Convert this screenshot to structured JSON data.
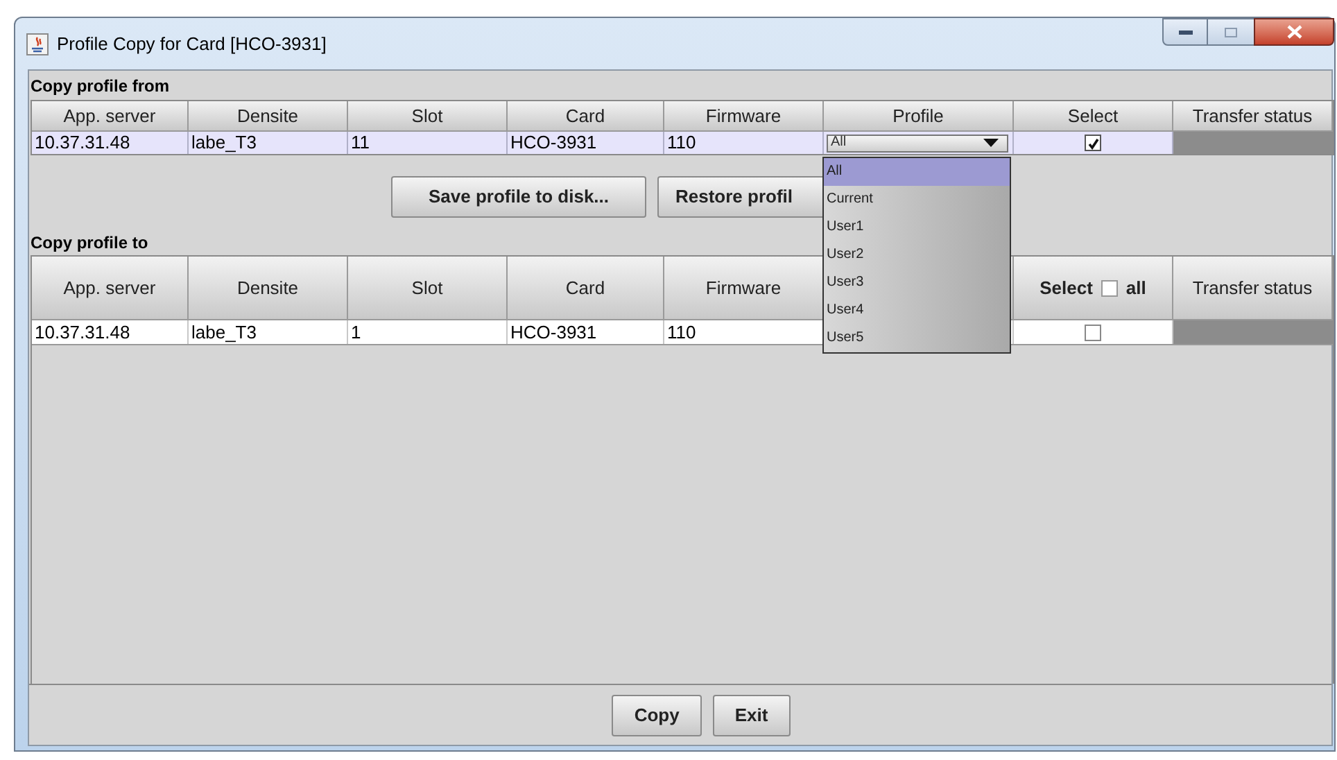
{
  "window": {
    "title": "Profile Copy for Card [HCO-3931]"
  },
  "copy_from": {
    "label": "Copy profile from",
    "columns": [
      "App. server",
      "Densite",
      "Slot",
      "Card",
      "Firmware",
      "Profile",
      "Select",
      "Transfer status"
    ],
    "rows": [
      {
        "cells": [
          "10.37.31.48",
          "labe_T3",
          "11",
          "HCO-3931",
          "110"
        ],
        "profile": "All",
        "checked": true
      }
    ]
  },
  "actions": [
    "Save profile to disk...",
    "Restore profil"
  ],
  "copy_to": {
    "label": "Copy profile to",
    "columns": [
      "App. server",
      "Densite",
      "Slot",
      "Card",
      "Firmware"
    ],
    "select_label": "Select",
    "all_label": "all",
    "all_checked": false,
    "status_label": "Transfer status",
    "rows": [
      {
        "cells": [
          "10.37.31.48",
          "labe_T3",
          "1",
          "HCO-3931",
          "110"
        ],
        "checked": false
      }
    ]
  },
  "profile_dropdown": {
    "options": [
      {
        "label": "All",
        "selected": true
      },
      {
        "label": "Current",
        "selected": false
      },
      {
        "label": "User1",
        "selected": false
      },
      {
        "label": "User2",
        "selected": false
      },
      {
        "label": "User3",
        "selected": false
      },
      {
        "label": "User4",
        "selected": false
      },
      {
        "label": "User5",
        "selected": false
      }
    ]
  },
  "footer_buttons": [
    "Copy",
    "Exit"
  ]
}
